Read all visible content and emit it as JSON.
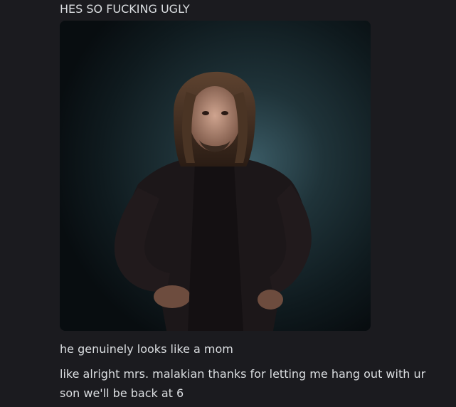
{
  "messages": [
    {
      "text": "HES SO FUCKING UGLY"
    },
    {
      "attachment": {
        "kind": "image",
        "description_icon": "photo-icon"
      }
    },
    {
      "text": "he genuinely looks like a mom"
    },
    {
      "text": "like alright mrs. malakian thanks for letting me hang out with ur son we'll be back at 6"
    }
  ],
  "colors": {
    "background": "#1b1b1f",
    "text": "#dbdee1"
  }
}
